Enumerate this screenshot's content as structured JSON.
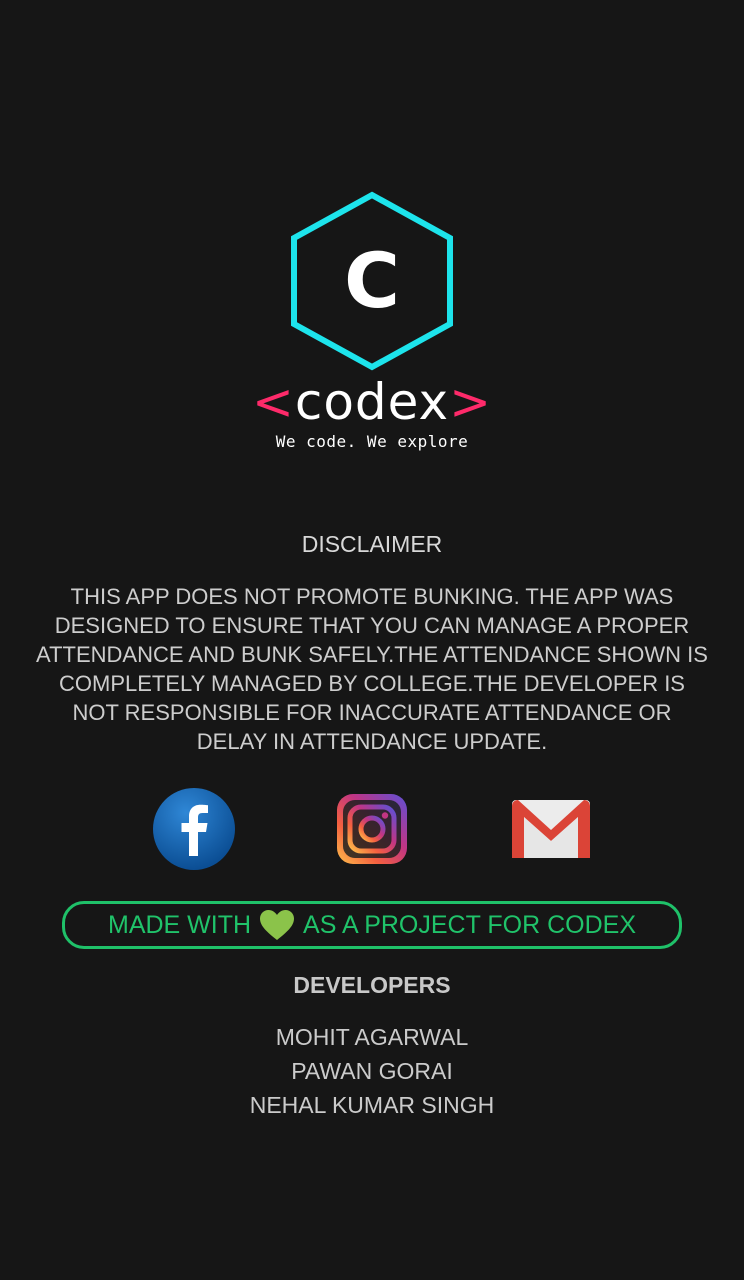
{
  "logo": {
    "mark_letter": "C",
    "brand_open": "<",
    "brand_name": "codex",
    "brand_close": ">",
    "tagline": "We code. We explore",
    "colors": {
      "hexagon": "#1de4ec",
      "brackets": "#fe2a6a",
      "text": "#ffffff"
    }
  },
  "disclaimer": {
    "title": "DISCLAIMER",
    "body": "THIS APP DOES NOT PROMOTE BUNKING. THE APP WAS DESIGNED TO ENSURE THAT YOU CAN MANAGE A PROPER ATTENDANCE AND BUNK SAFELY.THE ATTENDANCE SHOWN IS COMPLETELY MANAGED BY COLLEGE.THE DEVELOPER IS NOT RESPONSIBLE FOR INACCURATE ATTENDANCE OR DELAY IN ATTENDANCE UPDATE."
  },
  "social": [
    {
      "name": "facebook",
      "icon": "facebook-icon"
    },
    {
      "name": "instagram",
      "icon": "instagram-icon"
    },
    {
      "name": "gmail",
      "icon": "gmail-icon"
    }
  ],
  "made_with": {
    "prefix": "MADE WITH",
    "icon": "heart-icon",
    "suffix": "AS A PROJECT FOR CODEX",
    "accent_color": "#1fc169",
    "heart_color": "#8bc34a"
  },
  "developers": {
    "title": "DEVELOPERS",
    "names": [
      "MOHIT AGARWAL",
      "PAWAN GORAI",
      "NEHAL KUMAR SINGH"
    ]
  }
}
